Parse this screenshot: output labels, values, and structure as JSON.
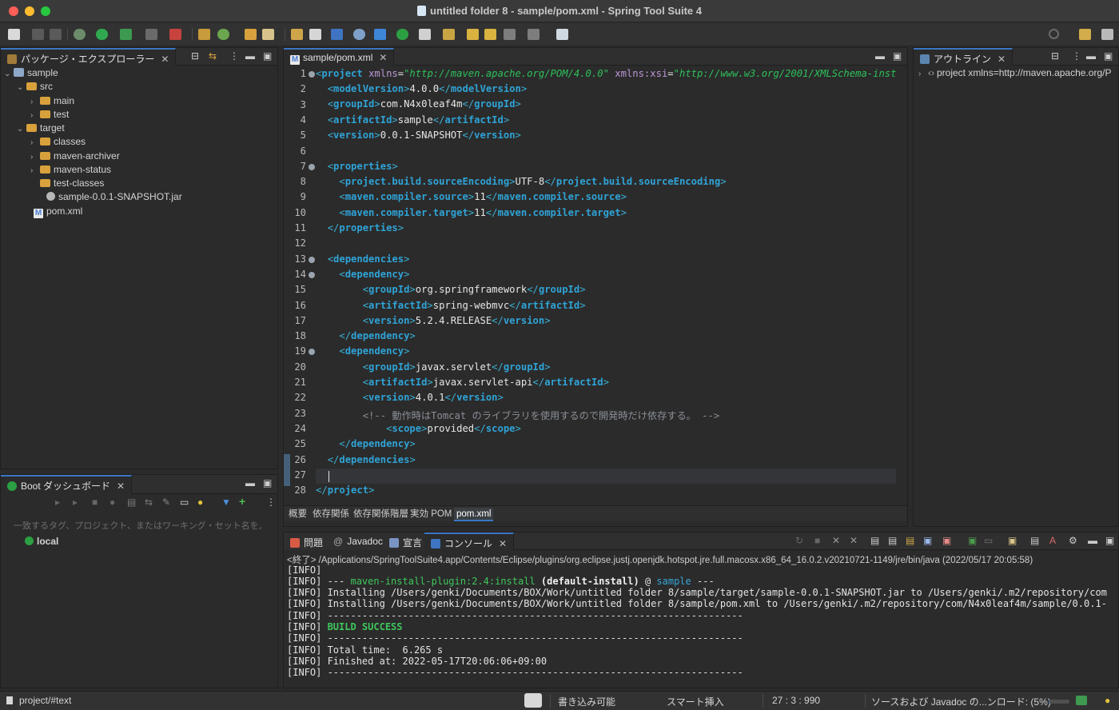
{
  "window": {
    "title": "untitled folder 8 - sample/pom.xml - Spring Tool Suite 4"
  },
  "toolbar": {
    "icons": [
      "new-icon",
      "save-icon",
      "save-all-icon",
      "debug-icon",
      "run-icon",
      "run-config-icon",
      "stop-icon",
      "relaunch-icon",
      "build-icon",
      "refresh-icon",
      "open-icon",
      "edit-icon",
      "task-icon",
      "bookmark-icon",
      "console-icon",
      "target-icon",
      "gear-icon",
      "boot-icon",
      "annotation-icon",
      "next-annotation-icon",
      "back-icon",
      "forward-icon",
      "back-arrow-icon",
      "forward-arrow-icon",
      "perspective-icon",
      "search-icon",
      "open-perspective-icon",
      "spring-perspective-icon"
    ]
  },
  "package_explorer": {
    "tab_label": "パッケージ・エクスプローラー",
    "tree": [
      {
        "label": "sample"
      },
      {
        "label": "src"
      },
      {
        "label": "main"
      },
      {
        "label": "test"
      },
      {
        "label": "target"
      },
      {
        "label": "classes"
      },
      {
        "label": "maven-archiver"
      },
      {
        "label": "maven-status"
      },
      {
        "label": "test-classes"
      },
      {
        "label": "sample-0.0.1-SNAPSHOT.jar"
      },
      {
        "label": "pom.xml"
      }
    ]
  },
  "boot_dashboard": {
    "tab_label": "Boot ダッシュボード",
    "filter_placeholder": "一致するタグ、プロジェクト、またはワーキング・セット名を入力",
    "items": [
      {
        "label": "local"
      }
    ]
  },
  "editor": {
    "tab_label": "sample/pom.xml",
    "cursor_line": 27,
    "lines": [
      {
        "n": "1"
      },
      {
        "n": "2"
      },
      {
        "n": "3"
      },
      {
        "n": "4"
      },
      {
        "n": "5"
      },
      {
        "n": "6"
      },
      {
        "n": "7"
      },
      {
        "n": "8"
      },
      {
        "n": "9"
      },
      {
        "n": "10"
      },
      {
        "n": "11"
      },
      {
        "n": "12"
      },
      {
        "n": "13"
      },
      {
        "n": "14"
      },
      {
        "n": "15"
      },
      {
        "n": "16"
      },
      {
        "n": "17"
      },
      {
        "n": "18"
      },
      {
        "n": "19"
      },
      {
        "n": "20"
      },
      {
        "n": "21"
      },
      {
        "n": "22"
      },
      {
        "n": "23"
      },
      {
        "n": "24"
      },
      {
        "n": "25"
      },
      {
        "n": "26"
      },
      {
        "n": "27"
      },
      {
        "n": "28"
      }
    ],
    "code": {
      "l1_tag": "project",
      "l1_attr1": "xmlns",
      "l1_val1": "\"http://maven.apache.org/POM/4.0.0\"",
      "l1_attr2": "xmlns:xsi",
      "l1_val2": "\"http://www.w3.org/2001/XMLSchema-inst",
      "modelVersion": "modelVersion",
      "modelVersion_val": "4.0.0",
      "groupId": "groupId",
      "groupId_val": "com.N4x0leaf4m",
      "artifactId": "artifactId",
      "artifactId_val": "sample",
      "version": "version",
      "version_val": "0.0.1-SNAPSHOT",
      "properties": "properties",
      "p1": "project.build.sourceEncoding",
      "p1_val": "UTF-8",
      "p2": "maven.compiler.source",
      "p2_val": "11",
      "p3": "maven.compiler.target",
      "p3_val": "11",
      "dependencies": "dependencies",
      "dependency": "dependency",
      "d1_group": "org.springframework",
      "d1_artifact": "spring-webmvc",
      "d1_version": "5.2.4.RELEASE",
      "d2_group": "javax.servlet",
      "d2_artifact": "javax.servlet-api",
      "d2_version": "4.0.1",
      "comment": "<!-- 動作時はTomcat のライブラリを使用するので開発時だけ依存する。 -->",
      "scope": "scope",
      "scope_val": "provided",
      "project_close": "project"
    },
    "bottom_tabs": [
      "概要",
      "依存関係",
      "依存関係階層",
      "実効 POM",
      "pom.xml"
    ],
    "active_bottom_tab": "pom.xml"
  },
  "outline": {
    "tab_label": "アウトライン",
    "item": "project xmlns=http://maven.apache.org/P"
  },
  "console_view": {
    "tabs": [
      "問題",
      "Javadoc",
      "宣言",
      "コンソール"
    ],
    "active_tab": "コンソール",
    "header": "<終了> /Applications/SpringToolSuite4.app/Contents/Eclipse/plugins/org.eclipse.justj.openjdk.hotspot.jre.full.macosx.x86_64_16.0.2.v20210721-1149/jre/bin/java (2022/05/17 20:05:58)",
    "lines": {
      "l1": "[INFO]",
      "l2_prefix": "[INFO] --- ",
      "l2_plugin": "maven-install-plugin:2.4:install",
      "l2_goal": " (default-install)",
      "l2_at": " @ ",
      "l2_project": "sample",
      "l2_suffix": " ---",
      "l3": "[INFO] Installing /Users/genki/Documents/BOX/Work/untitled folder 8/sample/target/sample-0.0.1-SNAPSHOT.jar to /Users/genki/.m2/repository/com",
      "l4": "[INFO] Installing /Users/genki/Documents/BOX/Work/untitled folder 8/sample/pom.xml to /Users/genki/.m2/repository/com/N4x0leaf4m/sample/0.0.1-",
      "l5": "[INFO] ------------------------------------------------------------------------",
      "l6_prefix": "[INFO] ",
      "l6_status": "BUILD SUCCESS",
      "l7": "[INFO] ------------------------------------------------------------------------",
      "l8": "[INFO] Total time:  6.265 s",
      "l9": "[INFO] Finished at: 2022-05-17T20:06:06+09:00",
      "l10": "[INFO] ------------------------------------------------------------------------"
    }
  },
  "statusbar": {
    "path": "project/#text",
    "writable": "書き込み可能",
    "insert_mode": "スマート挿入",
    "position": "27 : 3 : 990",
    "progress": "ソースおよび Javadoc の...ンロード: (5%)",
    "progress_fraction": 0.05
  },
  "colors": {
    "accent": "#3a76c4",
    "tag": "#3ab0d6",
    "success": "#3ec75c"
  }
}
